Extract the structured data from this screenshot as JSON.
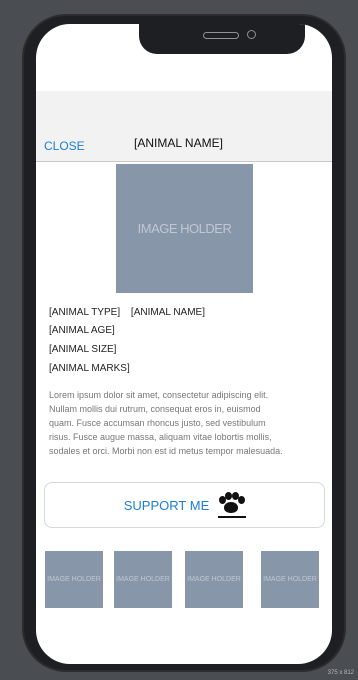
{
  "header": {
    "close_label": "CLOSE",
    "title": "[ANIMAL NAME]"
  },
  "hero_image": {
    "label": "IMAGE HOLDER"
  },
  "details": {
    "animal_type": "[ANIMAL TYPE]",
    "animal_name": "[ANIMAL NAME]",
    "animal_age": "[ANIMAL AGE]",
    "animal_size": "[ANIMAL SIZE]",
    "animal_marks": "[ANIMAL MARKS]"
  },
  "description": {
    "text": "Lorem ipsum dolor sit amet, consectetur adipiscing elit. Nullam mollis dui rutrum, consequat eros in, euismod quam. Fusce accumsan rhoncus justo, sed vestibulum risus. Fusce augue massa, aliquam vitae lobortis mollis, sodales et orci. Morbi non est id metus tempor malesuada."
  },
  "support": {
    "label": "SUPPORT ME",
    "icon": "paw-icon"
  },
  "thumbnails": [
    {
      "label": "IMAGE HOLDER"
    },
    {
      "label": "IMAGE HOLDER"
    },
    {
      "label": "IMAGE HOLDER"
    },
    {
      "label": "IMAGE HOLDER"
    }
  ],
  "device": {
    "size_label": "375 x 812"
  },
  "colors": {
    "accent": "#1a7fd8",
    "image_placeholder": "#8796a8"
  }
}
